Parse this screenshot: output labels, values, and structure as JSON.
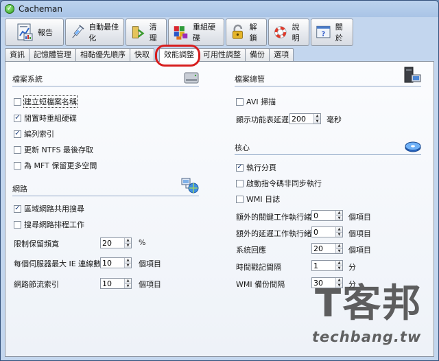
{
  "window": {
    "title": "Cacheman",
    "app_icon_glyph": "✓"
  },
  "toolbar": {
    "buttons": [
      {
        "label": "報告",
        "icon": "report-icon"
      },
      {
        "label": "自動最佳化",
        "icon": "syringe-icon"
      },
      {
        "label": "清理",
        "icon": "broom-icon"
      },
      {
        "label": "重組硬碟",
        "icon": "blocks-icon"
      },
      {
        "label": "解鎖",
        "icon": "padlock-icon"
      },
      {
        "label": "說明",
        "icon": "lifebuoy-icon"
      },
      {
        "label": "關於",
        "icon": "help-dialog-icon"
      }
    ]
  },
  "tabs": [
    {
      "label": "資訊"
    },
    {
      "label": "記憶體管理"
    },
    {
      "label": "相黏優先順序"
    },
    {
      "label": "快取"
    },
    {
      "label": "效能調整",
      "active": true
    },
    {
      "label": "可用性調整"
    },
    {
      "label": "備份"
    },
    {
      "label": "選項"
    }
  ],
  "file_system": {
    "title": "檔案系統",
    "options": [
      {
        "label": "建立短檔案名稱",
        "checked": false
      },
      {
        "label": "閒置時重組硬碟",
        "checked": true
      },
      {
        "label": "編列索引",
        "checked": true
      },
      {
        "label": "更新 NTFS 最後存取",
        "checked": false
      },
      {
        "label": "為 MFT 保留更多空間",
        "checked": false
      }
    ]
  },
  "network": {
    "title": "網路",
    "options": [
      {
        "label": "區域網路共用搜尋",
        "checked": true
      },
      {
        "label": "搜尋網路排程工作",
        "checked": false
      }
    ],
    "fields": [
      {
        "label": "限制保留頻寬",
        "value": "20",
        "unit": "%"
      },
      {
        "label": "每個伺服器最大 IE 連線數",
        "value": "10",
        "unit": "個項目"
      },
      {
        "label": "網路節流索引",
        "value": "10",
        "unit": "個項目"
      }
    ]
  },
  "file_manager": {
    "title": "檔案總管",
    "options": [
      {
        "label": "AVI 掃描",
        "checked": false
      }
    ],
    "fields": [
      {
        "label": "顯示功能表延遲",
        "value": "200",
        "unit": "毫秒"
      }
    ]
  },
  "kernel": {
    "title": "核心",
    "options": [
      {
        "label": "執行分頁",
        "checked": true
      },
      {
        "label": "啟動指令碼非同步執行",
        "checked": false
      },
      {
        "label": "WMI 日誌",
        "checked": false
      }
    ],
    "fields": [
      {
        "label": "額外的關鍵工作執行緒",
        "value": "0",
        "unit": "個項目"
      },
      {
        "label": "額外的延遲工作執行緒",
        "value": "0",
        "unit": "個項目"
      },
      {
        "label": "系統回應",
        "value": "20",
        "unit": "個項目"
      },
      {
        "label": "時間戳記間隔",
        "value": "1",
        "unit": "分"
      },
      {
        "label": "WMI 備份間隔",
        "value": "30",
        "unit": "分"
      }
    ]
  },
  "watermark": {
    "big": "T客邦",
    "small": "techbang.tw"
  },
  "colors": {
    "highlight_ring": "#d71d1d",
    "check": "#1b3d7a"
  }
}
